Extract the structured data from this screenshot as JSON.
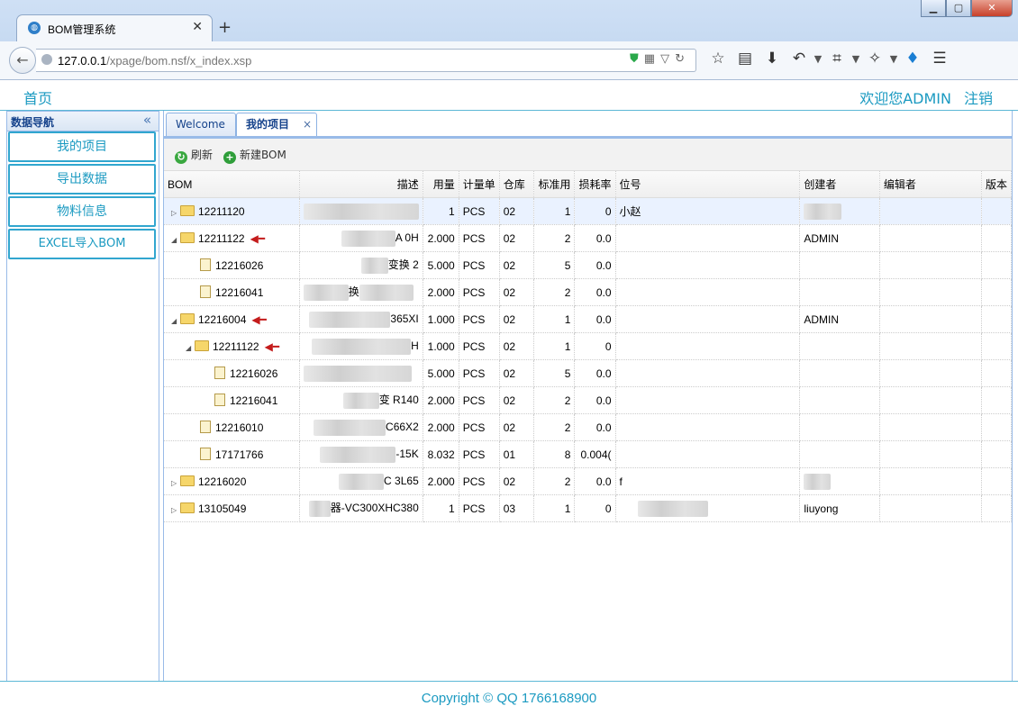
{
  "browser": {
    "tab_title": "BOM管理系统",
    "url_host": "127.0.0.1",
    "url_path": "/xpage/bom.nsf/x_index.xsp"
  },
  "header": {
    "home": "首页",
    "welcome": "欢迎您ADMIN",
    "logout": "注销"
  },
  "sidebar": {
    "title": "数据导航",
    "items": [
      {
        "label": "我的项目"
      },
      {
        "label": "导出数据"
      },
      {
        "label": "物料信息"
      },
      {
        "label": "EXCEL导入BOM"
      }
    ]
  },
  "tabs": [
    {
      "label": "Welcome"
    },
    {
      "label": "我的项目"
    }
  ],
  "toolbar": {
    "refresh": "刷新",
    "new_bom": "新建BOM"
  },
  "grid": {
    "columns": [
      "BOM",
      "描述",
      "用量",
      "计量单",
      "仓库",
      "标准用",
      "损耗率",
      "位号",
      "创建者",
      "编辑者",
      "版本"
    ],
    "rows": [
      {
        "bom": "12211120",
        "desc": "",
        "qty": "1",
        "unit": "PCS",
        "wh": "02",
        "std": "1",
        "loss": "0",
        "pos": "小赵",
        "creator": "",
        "editor": "",
        "ver": ""
      },
      {
        "bom": "12211122",
        "desc": "A      0H",
        "qty": "2.000",
        "unit": "PCS",
        "wh": "02",
        "std": "2",
        "loss": "0.0",
        "pos": "",
        "creator": "ADMIN",
        "editor": "",
        "ver": ""
      },
      {
        "bom": "12216026",
        "desc": "变换     2",
        "qty": "5.000",
        "unit": "PCS",
        "wh": "02",
        "std": "5",
        "loss": "0.0",
        "pos": "",
        "creator": "",
        "editor": "",
        "ver": ""
      },
      {
        "bom": "12216041",
        "desc": "换",
        "qty": "2.000",
        "unit": "PCS",
        "wh": "02",
        "std": "2",
        "loss": "0.0",
        "pos": "",
        "creator": "",
        "editor": "",
        "ver": ""
      },
      {
        "bom": "12216004",
        "desc": "365XI",
        "qty": "1.000",
        "unit": "PCS",
        "wh": "02",
        "std": "1",
        "loss": "0.0",
        "pos": "",
        "creator": "ADMIN",
        "editor": "",
        "ver": ""
      },
      {
        "bom": "12211122",
        "desc": "H",
        "qty": "1.000",
        "unit": "PCS",
        "wh": "02",
        "std": "1",
        "loss": "0",
        "pos": "",
        "creator": "",
        "editor": "",
        "ver": ""
      },
      {
        "bom": "12216026",
        "desc": "",
        "qty": "5.000",
        "unit": "PCS",
        "wh": "02",
        "std": "5",
        "loss": "0.0",
        "pos": "",
        "creator": "",
        "editor": "",
        "ver": ""
      },
      {
        "bom": "12216041",
        "desc": "变    R140",
        "qty": "2.000",
        "unit": "PCS",
        "wh": "02",
        "std": "2",
        "loss": "0.0",
        "pos": "",
        "creator": "",
        "editor": "",
        "ver": ""
      },
      {
        "bom": "12216010",
        "desc": "C66X2",
        "qty": "2.000",
        "unit": "PCS",
        "wh": "02",
        "std": "2",
        "loss": "0.0",
        "pos": "",
        "creator": "",
        "editor": "",
        "ver": ""
      },
      {
        "bom": "17171766",
        "desc": "-15K",
        "qty": "8.032",
        "unit": "PCS",
        "wh": "01",
        "std": "8",
        "loss": "0.004(",
        "pos": "",
        "creator": "",
        "editor": "",
        "ver": ""
      },
      {
        "bom": "12216020",
        "desc": "C    3L65",
        "qty": "2.000",
        "unit": "PCS",
        "wh": "02",
        "std": "2",
        "loss": "0.0",
        "pos": "f",
        "creator": "",
        "editor": "",
        "ver": ""
      },
      {
        "bom": "13105049",
        "desc": "器-VC300XHC380",
        "qty": "1",
        "unit": "PCS",
        "wh": "03",
        "std": "1",
        "loss": "0",
        "pos": "",
        "creator": "liuyong",
        "editor": "",
        "ver": ""
      }
    ]
  },
  "footer": {
    "copyright": "Copyright © QQ 1766168900"
  }
}
